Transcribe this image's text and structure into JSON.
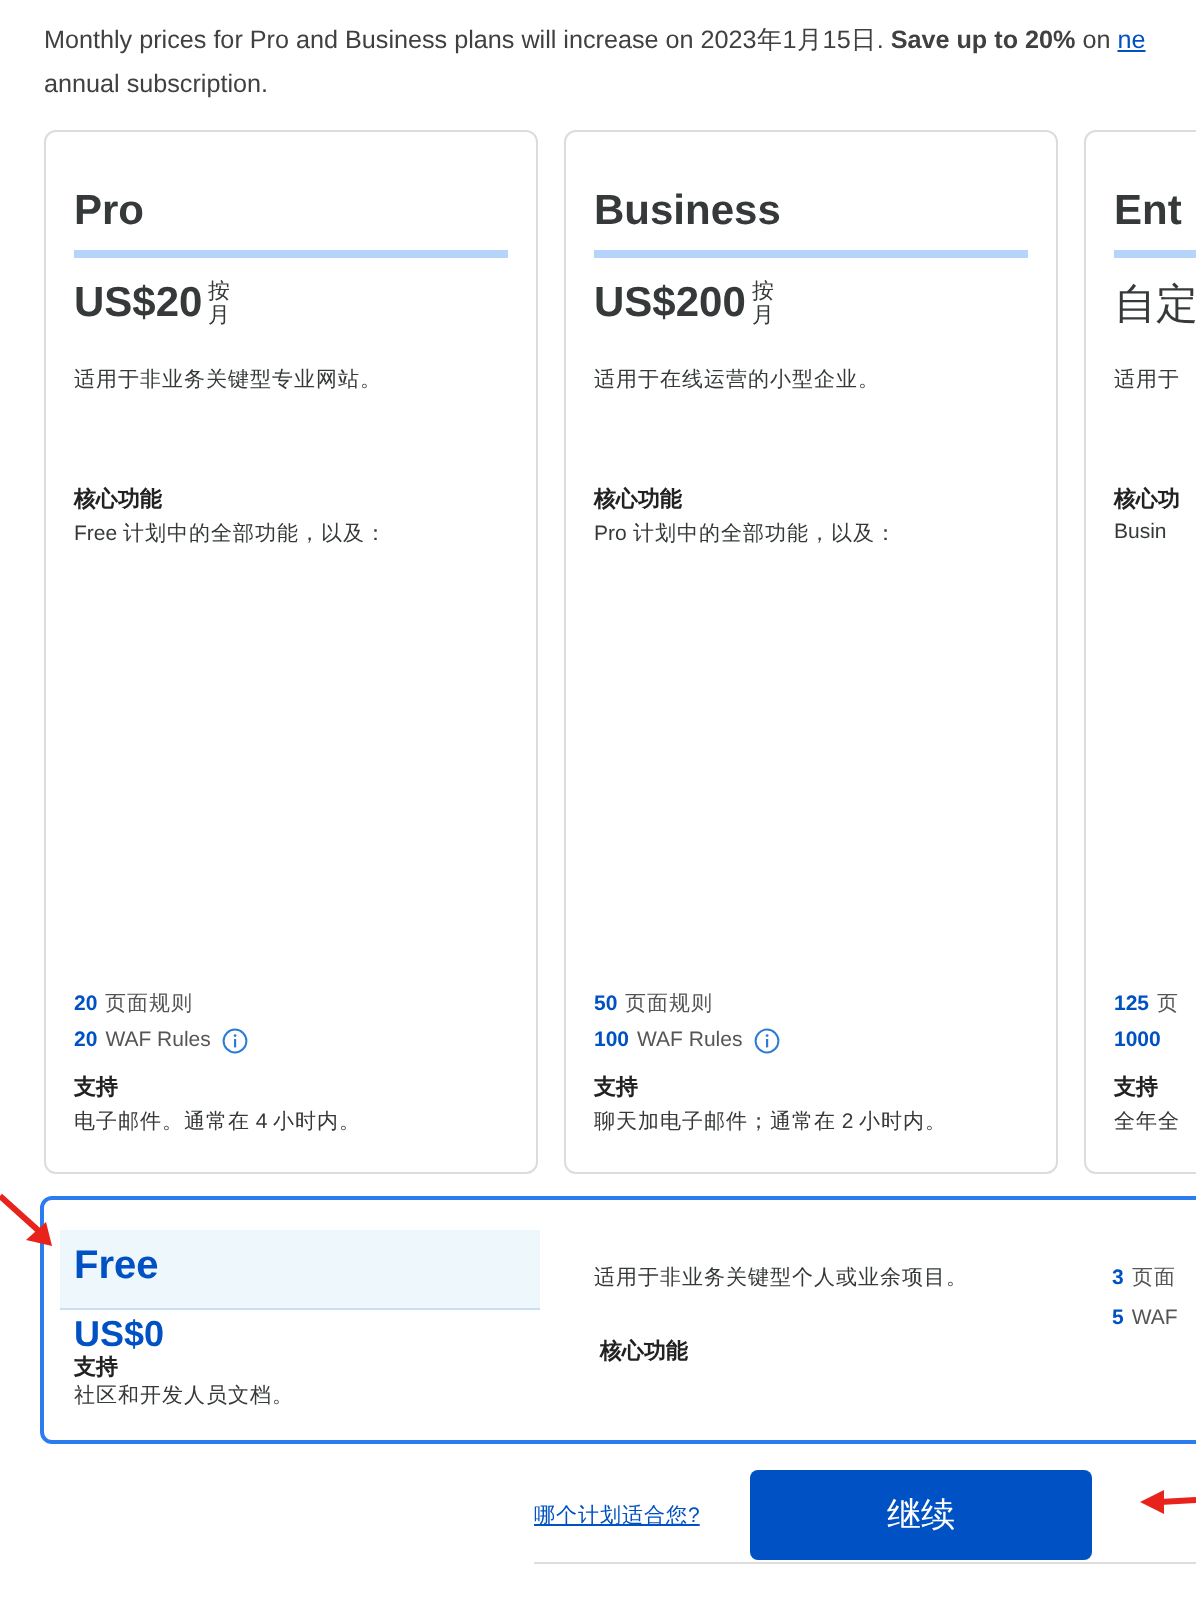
{
  "notice": {
    "text": "Monthly prices for Pro and Business plans will increase on 2023年1月15日. **Save up to 20%** on",
    "link": "ne",
    "text_after": "annual subscription."
  },
  "plans": [
    {
      "name": "Pro",
      "price": "US$20",
      "period": "按月",
      "description": "适用于非业务关键型专业网站。",
      "core_title": "核心功能",
      "core_text": "Free 计划中的全部功能，以及：",
      "rules": [
        {
          "count": "20",
          "label": "页面规则",
          "info": false
        },
        {
          "count": "20",
          "label": "WAF Rules",
          "info": true
        }
      ],
      "support_title": "支持",
      "support_text": "电子邮件。通常在 4 小时内。",
      "selected": false
    },
    {
      "name": "Business",
      "price": "US$200",
      "period": "按月",
      "description": "适用于在线运营的小型企业。",
      "core_title": "核心功能",
      "core_text": "Pro 计划中的全部功能，以及：",
      "rules": [
        {
          "count": "50",
          "label": "页面规则",
          "info": false
        },
        {
          "count": "100",
          "label": "WAF Rules",
          "info": true
        }
      ],
      "support_title": "支持",
      "support_text": "聊天加电子邮件；通常在 2 小时内。",
      "selected": false
    },
    {
      "name": "Ent",
      "price": "自定",
      "description": "适用于",
      "core_title": "核心功",
      "core_text": "Busin",
      "rules": [
        {
          "count": "125",
          "label": "页",
          "info": false
        },
        {
          "count": "1000",
          "info": false
        }
      ],
      "support_title": "支持",
      "support_text": "全年全",
      "selected": false
    }
  ],
  "free_plan": {
    "name": "Free",
    "price": "US$0",
    "support_title": "支持",
    "support_text": "社区和开发人员文档。",
    "description": "适用于非业务关键型个人或业余项目。",
    "core_title": "核心功能",
    "rules": [
      {
        "count": "3",
        "label": "页面"
      },
      {
        "count": "5",
        "label": "WAF"
      }
    ],
    "selected": true
  },
  "help_link": "哪个计划适合您?",
  "continue_button": "继续"
}
